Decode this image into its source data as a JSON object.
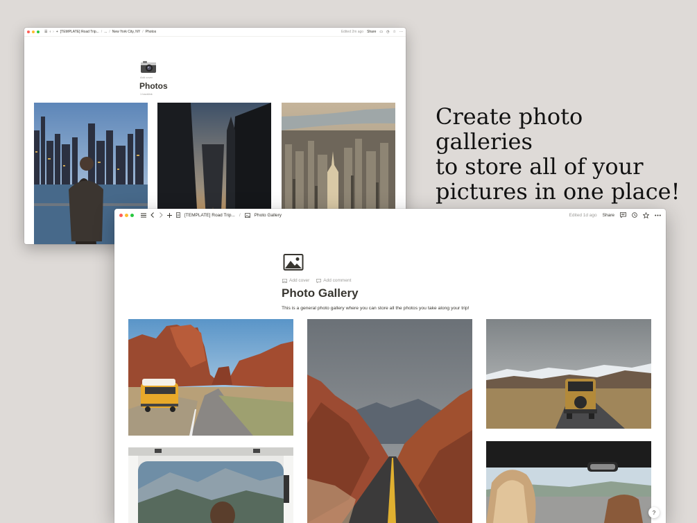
{
  "back_window": {
    "breadcrumb": [
      "[TEMPLATE] Road Trip...",
      "...",
      "New York City, NY",
      "Photos"
    ],
    "edited": "Edited 2m ago",
    "share": "Share",
    "add_cover": "Add cover",
    "title": "Photos",
    "backlink": "1 backlink",
    "photos": [
      "city-skyline-person",
      "dark-street-sunset",
      "aerial-city"
    ],
    "page_icon": "camera-icon"
  },
  "caption": {
    "line1": "Create photo galleries",
    "line2": "to store all of your",
    "line3": "pictures in one place!"
  },
  "front_window": {
    "breadcrumb": [
      "[TEMPLATE] Road Trip...",
      "Photo Gallery"
    ],
    "edited": "Edited 1d ago",
    "share": "Share",
    "add_cover": "Add cover",
    "add_comment": "Add comment",
    "title": "Photo Gallery",
    "description": "This is a general photo gallery where you can store all the photos you take along your trip!",
    "help": "?",
    "page_icon": "image-icon",
    "photos": [
      "desert-van-red-rocks",
      "desert-road-canyon",
      "van-mountain-road",
      "van-interior-mountains",
      "car-driver-woman"
    ]
  },
  "colors": {
    "background": "#dedad7",
    "text": "#37352f",
    "muted": "#9b9a97",
    "traffic_red": "#fe5f57",
    "traffic_yellow": "#febc2e",
    "traffic_green": "#28c840"
  }
}
